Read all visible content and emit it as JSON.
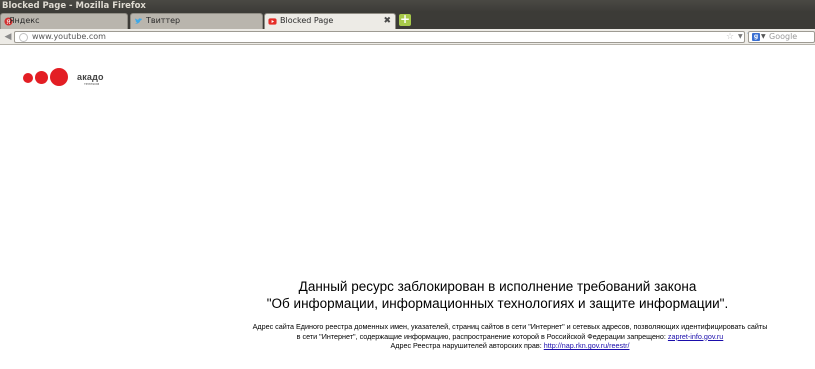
{
  "window": {
    "title": "Blocked Page - Mozilla Firefox"
  },
  "tabs": [
    {
      "label": "Яндекс",
      "favicon": "yandex-icon",
      "favicon_color": "#d32f2f"
    },
    {
      "label": "Твиттер",
      "favicon": "twitter-icon",
      "favicon_color": "#3fa9e8"
    },
    {
      "label": "Blocked Page",
      "favicon": "youtube-icon",
      "favicon_color": "#e52d27",
      "active": true,
      "close": "✖"
    }
  ],
  "navbar": {
    "url": "www.youtube.com",
    "search_placeholder": "Google"
  },
  "logo": {
    "name": "акадо",
    "sub": "телеком",
    "color": "#e31e24"
  },
  "page": {
    "title_line1": "Данный ресурс заблокирован в исполнение требований закона",
    "title_line2": "\"Об информации, информационных технологиях и защите информации\".",
    "notice_line1": "Адрес сайта Единого реестра доменных имен, указателей, страниц сайтов в сети \"Интернет\" и сетевых адресов, позволяющих идентифицировать сайты",
    "notice_line2_text": "в сети \"Интернет\", содержащие информацию, распространение которой в Российской Федерации запрещено: ",
    "notice_line2_link": "zapret-info.gov.ru",
    "notice_line3_text": "Адрес Реестра нарушителей авторских прав: ",
    "notice_line3_link": "http://nap.rkn.gov.ru/reestr/"
  }
}
